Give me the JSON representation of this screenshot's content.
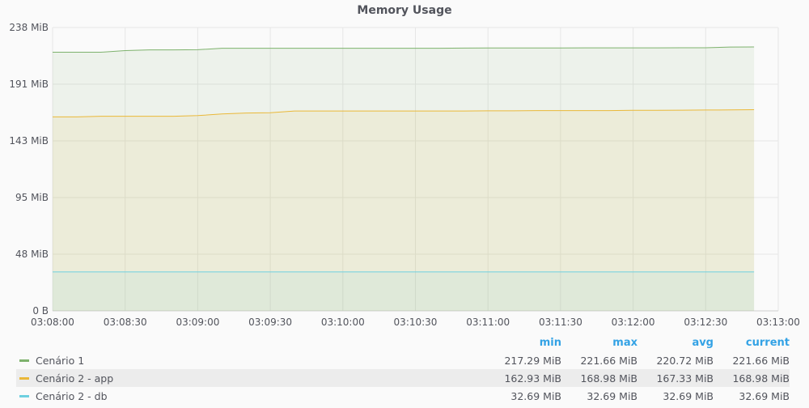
{
  "chart_data": {
    "type": "area",
    "title": "Memory Usage",
    "ylim": [
      0,
      238
    ],
    "y_ticks": [
      "0 B",
      "48 MiB",
      "95 MiB",
      "143 MiB",
      "191 MiB",
      "238 MiB"
    ],
    "y_tick_values": [
      0,
      47.6,
      95.2,
      142.8,
      190.4,
      238
    ],
    "x_ticks": [
      "03:08:00",
      "03:08:30",
      "03:09:00",
      "03:09:30",
      "03:10:00",
      "03:10:30",
      "03:11:00",
      "03:11:30",
      "03:12:00",
      "03:12:30",
      "03:13:00"
    ],
    "x": [
      "03:08:00",
      "03:08:10",
      "03:08:20",
      "03:08:30",
      "03:08:40",
      "03:08:50",
      "03:09:00",
      "03:09:10",
      "03:09:20",
      "03:09:30",
      "03:09:40",
      "03:09:50",
      "03:10:00",
      "03:10:10",
      "03:10:20",
      "03:10:30",
      "03:10:40",
      "03:10:50",
      "03:11:00",
      "03:11:10",
      "03:11:20",
      "03:11:30",
      "03:11:40",
      "03:11:50",
      "03:12:00",
      "03:12:10",
      "03:12:20",
      "03:12:30",
      "03:12:40",
      "03:12:50"
    ],
    "series": [
      {
        "name": "Cenário 1",
        "color": "#7eb26d",
        "values": [
          217.29,
          217.29,
          217.29,
          218.6,
          219.2,
          219.2,
          219.4,
          220.6,
          220.6,
          220.6,
          220.6,
          220.6,
          220.6,
          220.6,
          220.6,
          220.6,
          220.6,
          220.7,
          220.8,
          220.8,
          220.8,
          220.8,
          220.9,
          220.9,
          220.9,
          220.9,
          221.0,
          221.0,
          221.6,
          221.66
        ]
      },
      {
        "name": "Cenário 2 - app",
        "color": "#eab839",
        "values": [
          162.93,
          162.93,
          163.5,
          163.5,
          163.5,
          163.5,
          164.0,
          165.4,
          166.2,
          166.4,
          167.9,
          167.9,
          167.9,
          167.9,
          167.9,
          167.9,
          167.9,
          167.9,
          168.0,
          168.0,
          168.2,
          168.2,
          168.2,
          168.2,
          168.5,
          168.5,
          168.6,
          168.7,
          168.8,
          168.98
        ]
      },
      {
        "name": "Cenário 2 - db",
        "color": "#6ed0e0",
        "values": [
          32.69,
          32.69,
          32.69,
          32.69,
          32.69,
          32.69,
          32.69,
          32.69,
          32.69,
          32.69,
          32.69,
          32.69,
          32.69,
          32.69,
          32.69,
          32.69,
          32.69,
          32.69,
          32.69,
          32.69,
          32.69,
          32.69,
          32.69,
          32.69,
          32.69,
          32.69,
          32.69,
          32.69,
          32.69,
          32.69
        ]
      }
    ]
  },
  "legend": {
    "headers": [
      "min",
      "max",
      "avg",
      "current"
    ],
    "rows": [
      {
        "name": "Cenário 1",
        "color": "#7eb26d",
        "min": "217.29 MiB",
        "max": "221.66 MiB",
        "avg": "220.72 MiB",
        "current": "221.66 MiB"
      },
      {
        "name": "Cenário 2 - app",
        "color": "#eab839",
        "min": "162.93 MiB",
        "max": "168.98 MiB",
        "avg": "167.33 MiB",
        "current": "168.98 MiB"
      },
      {
        "name": "Cenário 2 - db",
        "color": "#6ed0e0",
        "min": "32.69 MiB",
        "max": "32.69 MiB",
        "avg": "32.69 MiB",
        "current": "32.69 MiB"
      }
    ]
  }
}
